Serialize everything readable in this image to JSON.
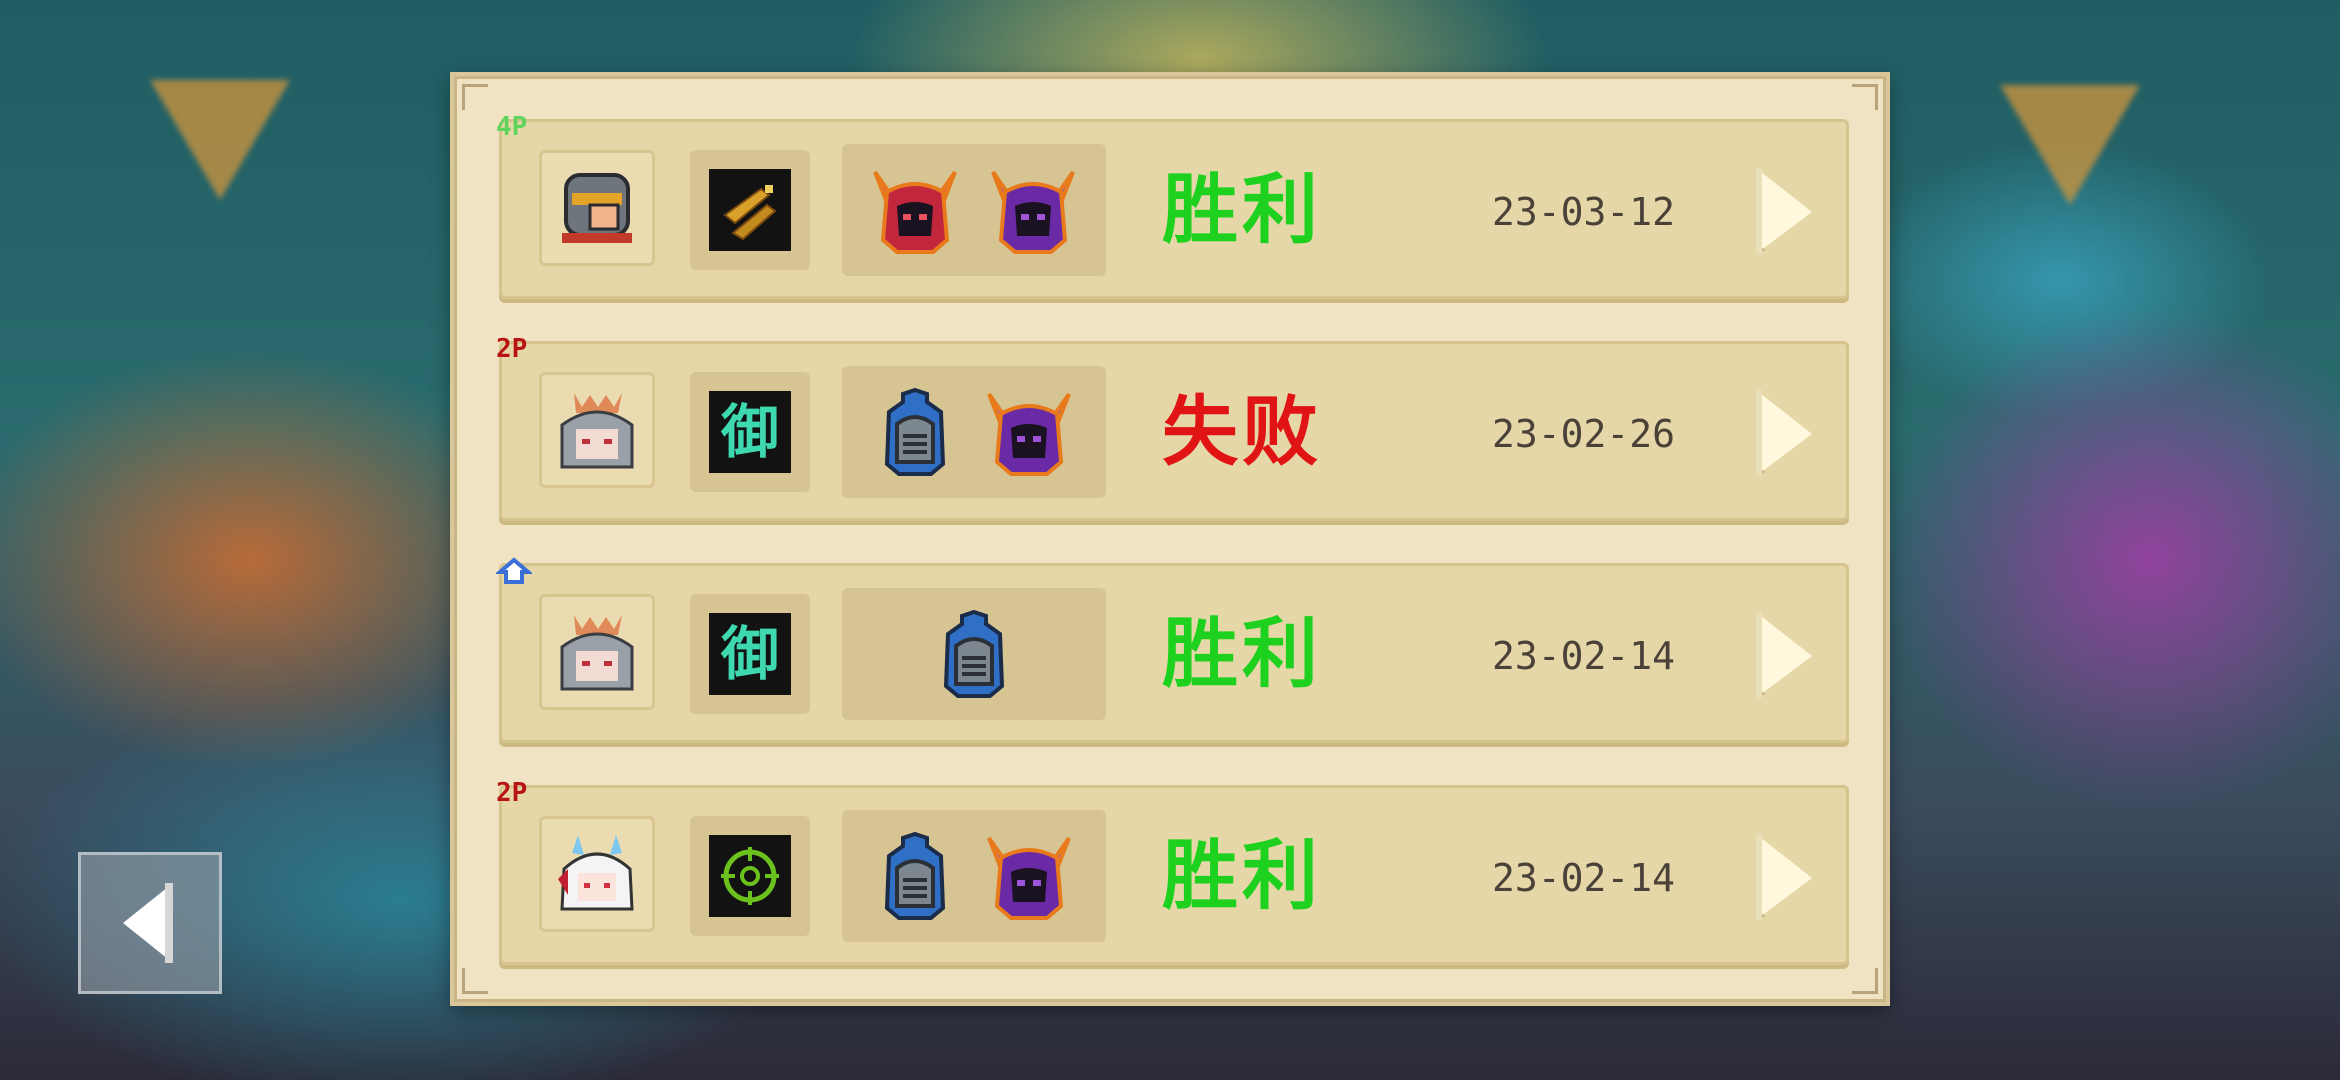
{
  "records": [
    {
      "mode": "4P",
      "mode_color": "#5fd35a",
      "hero": "knight-hero",
      "weapon": "golden-gun",
      "bosses": [
        "red-demon-boss",
        "purple-demon-boss"
      ],
      "result": "胜利",
      "result_color": "#1fd11f",
      "date": "23-03-12"
    },
    {
      "mode": "2P",
      "mode_color": "#b81414",
      "hero": "silver-hair-hero",
      "weapon": "defense-glyph",
      "bosses": [
        "blue-knight-boss",
        "purple-demon-boss"
      ],
      "result": "失败",
      "result_color": "#e01414",
      "date": "23-02-26"
    },
    {
      "mode": "",
      "mode_icon": "home-icon",
      "mode_color": "#3a6fd8",
      "hero": "silver-hair-hero",
      "weapon": "defense-glyph",
      "bosses": [
        "blue-knight-boss"
      ],
      "result": "胜利",
      "result_color": "#1fd11f",
      "date": "23-02-14"
    },
    {
      "mode": "2P",
      "mode_color": "#b81414",
      "hero": "white-hair-hero",
      "weapon": "target-scope",
      "bosses": [
        "blue-knight-boss",
        "purple-demon-boss"
      ],
      "result": "胜利",
      "result_color": "#1fd11f",
      "date": "23-02-14"
    }
  ],
  "weapon_glyph": "御",
  "back_icon": "back-arrow-icon"
}
